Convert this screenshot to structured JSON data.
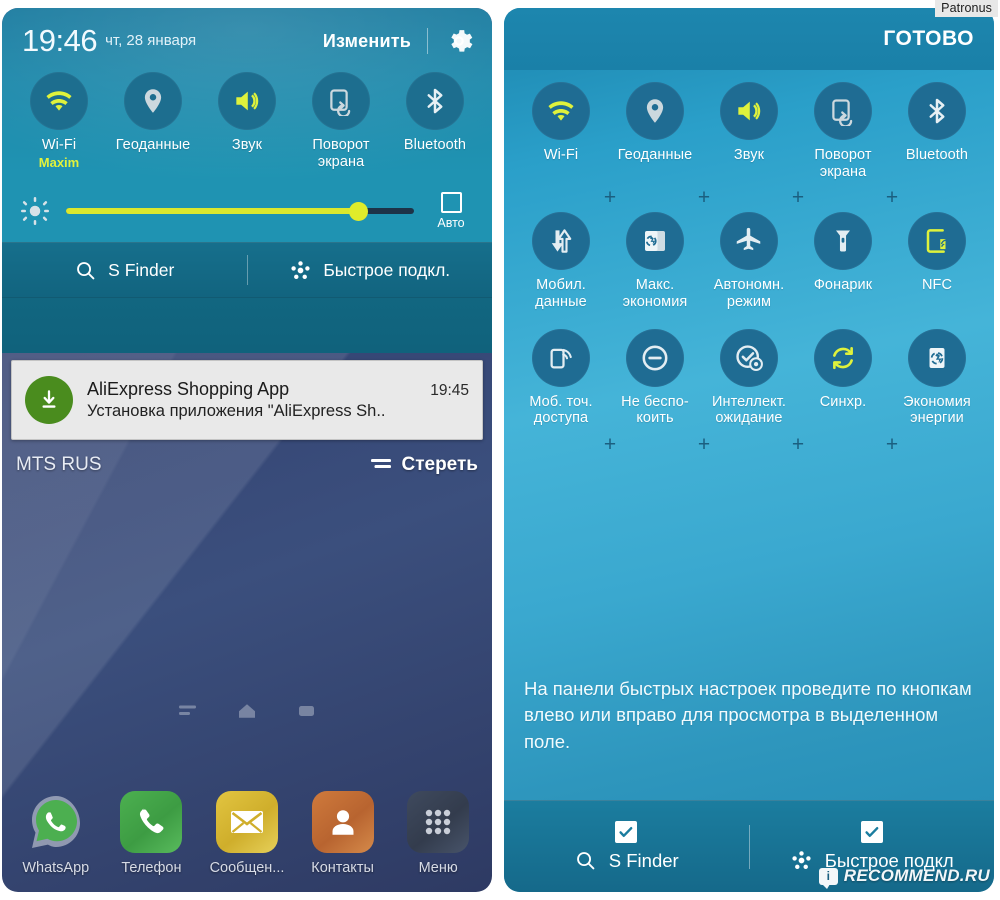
{
  "watermarks": {
    "corner_label": "Patronus",
    "site_badge": "i",
    "site_name": "RECOMMEND.RU"
  },
  "left_panel": {
    "status": {
      "time": "19:46",
      "date": "чт, 28 января"
    },
    "header": {
      "edit_label": "Изменить",
      "settings_icon": "gear-icon"
    },
    "quick_toggles": [
      {
        "label": "Wi-Fi",
        "sub": "Maxim",
        "icon": "wifi-icon",
        "active": true
      },
      {
        "label": "Геоданные",
        "sub": "",
        "icon": "location-pin-icon",
        "active": false
      },
      {
        "label": "Звук",
        "sub": "",
        "icon": "sound-speaker-icon",
        "active": true
      },
      {
        "label": "Поворот экрана",
        "sub": "",
        "icon": "screen-rotation-icon",
        "active": false
      },
      {
        "label": "Bluetooth",
        "sub": "",
        "icon": "bluetooth-icon",
        "active": false
      }
    ],
    "brightness": {
      "icon": "brightness-sun-icon",
      "value_percent": 84,
      "auto_label": "Авто",
      "auto_checked": false,
      "fill_color": "#dbe82e",
      "track_color": "#1d3348"
    },
    "finder_bar": [
      {
        "label": "S Finder",
        "icon": "search-icon"
      },
      {
        "label": "Быстрое подкл.",
        "icon": "quick-connect-icon"
      }
    ],
    "notification": {
      "icon": "download-icon",
      "title": "AliExpress Shopping App",
      "time": "19:45",
      "subtitle": "Установка приложения \"AliExpress Sh.."
    },
    "carrier": {
      "name": "MTS RUS",
      "clear_label": "Стереть",
      "clear_icon": "clear-all-icon"
    },
    "nav_buttons": [
      {
        "name": "recents-button",
        "icon": "recents-icon"
      },
      {
        "name": "home-button",
        "icon": "home-icon"
      },
      {
        "name": "back-button",
        "icon": "back-icon"
      }
    ],
    "dock": [
      {
        "label": "WhatsApp",
        "icon": "whatsapp-icon"
      },
      {
        "label": "Телефон",
        "icon": "phone-icon"
      },
      {
        "label": "Сообщен...",
        "icon": "message-envelope-icon"
      },
      {
        "label": "Контакты",
        "icon": "contacts-person-icon"
      },
      {
        "label": "Меню",
        "icon": "apps-grid-icon"
      }
    ]
  },
  "right_panel": {
    "header": {
      "done_label": "ГОТОВО"
    },
    "rows": [
      [
        {
          "label": "Wi-Fi",
          "icon": "wifi-icon",
          "active": true
        },
        {
          "label": "Геоданные",
          "icon": "location-pin-icon",
          "active": false
        },
        {
          "label": "Звук",
          "icon": "sound-speaker-icon",
          "active": true
        },
        {
          "label": "Поворот экрана",
          "icon": "screen-rotation-icon",
          "active": false
        },
        {
          "label": "Bluetooth",
          "icon": "bluetooth-icon",
          "active": false
        }
      ],
      [
        {
          "label": "Мобил. данные",
          "icon": "mobile-data-icon",
          "active": false
        },
        {
          "label": "Макс. экономия",
          "icon": "ultra-power-saving-icon",
          "active": false
        },
        {
          "label": "Автономн. режим",
          "icon": "airplane-icon",
          "active": false
        },
        {
          "label": "Фонарик",
          "icon": "flashlight-icon",
          "active": false
        },
        {
          "label": "NFC",
          "icon": "nfc-icon",
          "active": true
        }
      ],
      [
        {
          "label": "Моб. точ. доступа",
          "icon": "hotspot-icon",
          "active": false
        },
        {
          "label": "Не беспо- коить",
          "icon": "do-not-disturb-icon",
          "active": false
        },
        {
          "label": "Интеллект. ожидание",
          "icon": "smart-stay-eye-icon",
          "active": false
        },
        {
          "label": "Синхр.",
          "icon": "sync-icon",
          "active": true
        },
        {
          "label": "Экономия энергии",
          "icon": "power-saving-icon",
          "active": false
        }
      ]
    ],
    "plus_glyph": "+",
    "hint": "На панели быстрых настроек проведите по кнопкам влево или вправо для просмотра в выделенном поле.",
    "footer": [
      {
        "label": "S Finder",
        "icon": "search-icon",
        "checked": true
      },
      {
        "label": "Быстрое подкл",
        "icon": "quick-connect-icon",
        "checked": true
      }
    ]
  },
  "colors": {
    "shade_blue": "#1f93b2",
    "tile_circle": "#1d6e8f",
    "accent_yellow": "#e2f23c",
    "right_bg_top": "#1c85ad",
    "right_bg_mid": "#45b4d8",
    "notification_bg": "#e9e9e9"
  }
}
